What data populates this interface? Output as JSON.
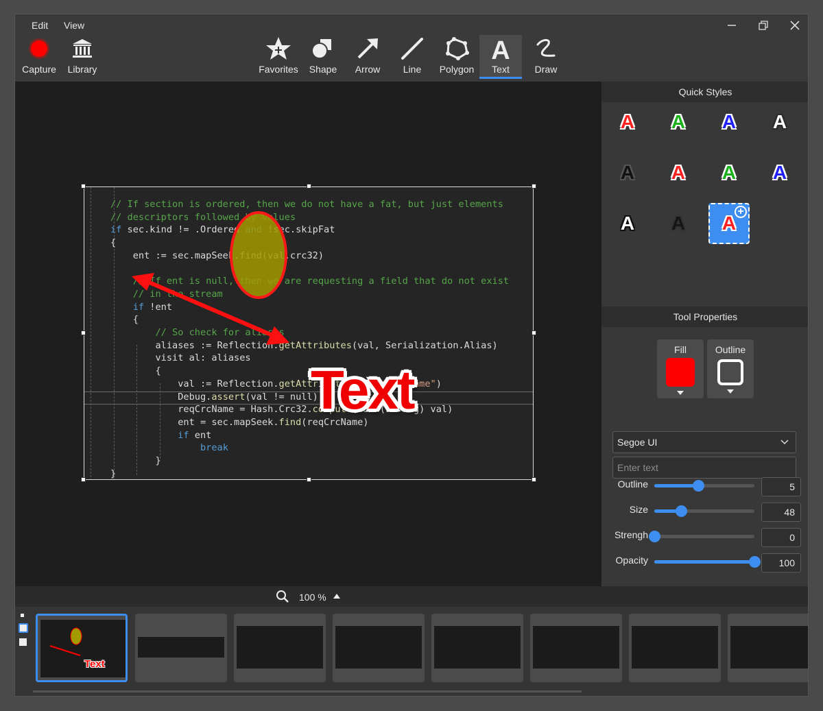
{
  "menu": {
    "edit": "Edit",
    "view": "View"
  },
  "toolbar": {
    "capture": "Capture",
    "library": "Library",
    "tools": [
      {
        "label": "Favorites",
        "icon": "star-plus-icon"
      },
      {
        "label": "Shape",
        "icon": "shape-icon"
      },
      {
        "label": "Arrow",
        "icon": "arrow-icon"
      },
      {
        "label": "Line",
        "icon": "line-icon"
      },
      {
        "label": "Polygon",
        "icon": "polygon-icon"
      },
      {
        "label": "Text",
        "icon": "text-icon",
        "active": true
      },
      {
        "label": "Draw",
        "icon": "draw-icon"
      }
    ]
  },
  "canvas": {
    "overlay_text": "Text",
    "code_lines": [
      "// If section is ordered, then we do not have a fat, but just elements",
      "// descriptors followed by values",
      "if sec.kind != .Ordered and !sec.skipFat",
      "{",
      "    ent := sec.mapSeek.find(val.crc32)",
      "",
      "    // If ent is null, then we are requesting a field that do not exist",
      "    // in the stream",
      "    if !ent",
      "    {",
      "        // So check for aliases",
      "        aliases := Reflection.getAttributes(val, Serialization.Alias)",
      "        visit al: aliases",
      "        {",
      "            val := Reflection.getAttributeValue(al, \"name\")",
      "            Debug.assert(val != null)",
      "            reqCrcName = Hash.Crc32.compute(cast(string) val)",
      "            ent = sec.mapSeek.find(reqCrcName)",
      "            if ent",
      "                break",
      "        }",
      "}"
    ]
  },
  "panel": {
    "quick_styles_title": "Quick Styles",
    "quick_style_letter": "A",
    "tool_properties_title": "Tool Properties",
    "fill_label": "Fill",
    "outline_label": "Outline",
    "font": "Segoe UI",
    "text_placeholder": "Enter text",
    "properties": [
      {
        "label": "Outline",
        "value": "5",
        "fraction": 0.44
      },
      {
        "label": "Size",
        "value": "48",
        "fraction": 0.27
      },
      {
        "label": "Strengh",
        "value": "0",
        "fraction": 0.0
      },
      {
        "label": "Opacity",
        "value": "100",
        "fraction": 1.0
      }
    ],
    "fill_color": "#ff0000",
    "accent": "#3d8ef0"
  },
  "zoom": {
    "value": "100 %"
  },
  "thumb_text": "Text"
}
